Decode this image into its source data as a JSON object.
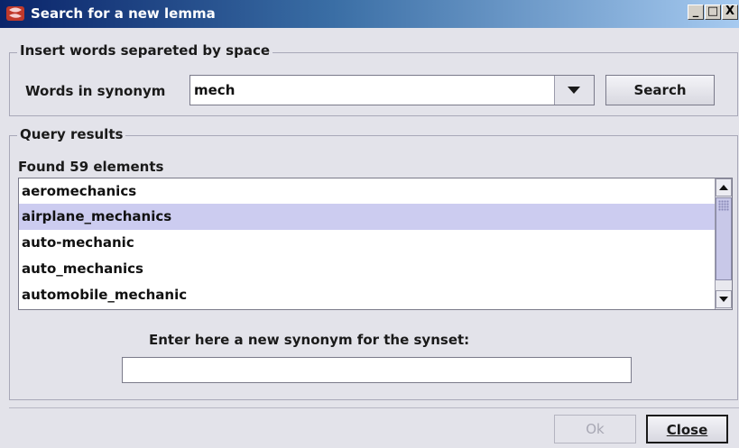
{
  "window": {
    "title": "Search for a new lemma",
    "controls": {
      "minimize": "_",
      "maximize": "□",
      "close": "X"
    }
  },
  "search_group": {
    "legend": "Insert words separeted by space",
    "field_label": "Words in synonym",
    "field_value": "mech",
    "search_button": "Search"
  },
  "results_group": {
    "legend": "Query results",
    "found_text": "Found 59 elements",
    "items": [
      {
        "label": "aeromechanics",
        "selected": false
      },
      {
        "label": "airplane_mechanics",
        "selected": true
      },
      {
        "label": "auto-mechanic",
        "selected": false
      },
      {
        "label": "auto_mechanics",
        "selected": false
      },
      {
        "label": "automobile_mechanic",
        "selected": false
      }
    ],
    "synonym_prompt": "Enter here a new synonym for the synset:",
    "synonym_value": ""
  },
  "footer": {
    "ok_label": "Ok",
    "close_label": "Close"
  },
  "colors": {
    "selection": "#ccccf0",
    "titlebar_start": "#0a246a",
    "titlebar_end": "#a6caf0"
  }
}
